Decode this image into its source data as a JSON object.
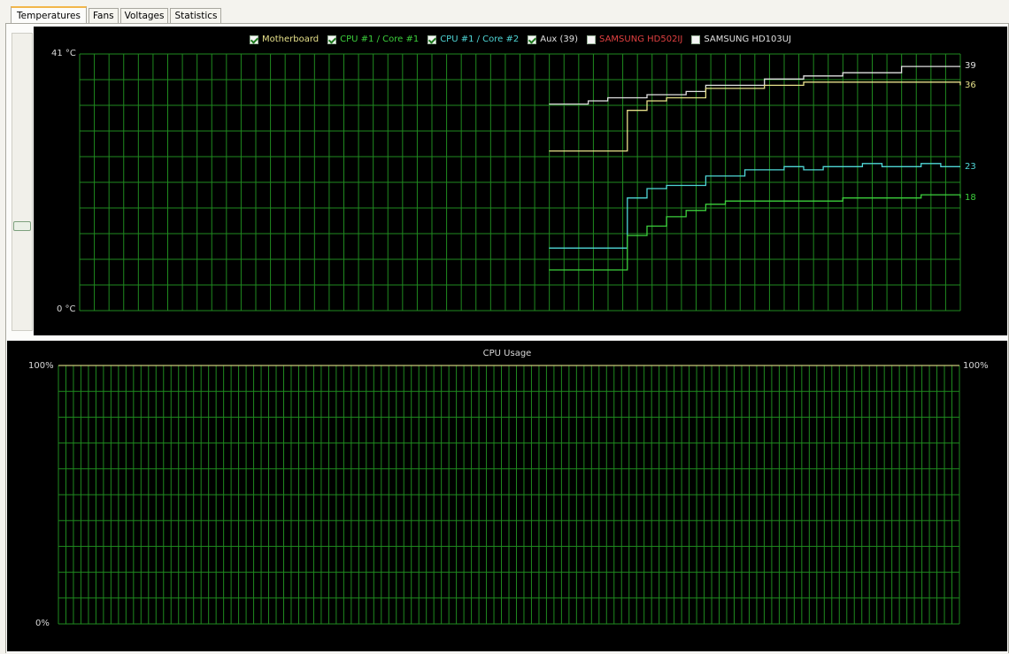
{
  "tabs": [
    {
      "label": "Temperatures",
      "active": true
    },
    {
      "label": "Fans",
      "active": false
    },
    {
      "label": "Voltages",
      "active": false
    },
    {
      "label": "Statistics",
      "active": false
    }
  ],
  "temperature_chart": {
    "legend": [
      {
        "label": "Motherboard",
        "checked": true,
        "color": "#e6e08a"
      },
      {
        "label": "CPU #1 / Core #1",
        "checked": true,
        "color": "#3ccf3c"
      },
      {
        "label": "CPU #1 / Core #2",
        "checked": true,
        "color": "#4fd6d6"
      },
      {
        "label": "Aux (39)",
        "checked": true,
        "color": "#e0e0e0"
      },
      {
        "label": "SAMSUNG HD502IJ",
        "checked": false,
        "color": "#e04040"
      },
      {
        "label": "SAMSUNG HD103UJ",
        "checked": false,
        "color": "#e0e0e0"
      }
    ],
    "y_max_label": "41 °C",
    "y_min_label": "0 °C",
    "end_labels": [
      {
        "text": "39",
        "color": "#e0e0e0"
      },
      {
        "text": "36",
        "color": "#e6e08a"
      },
      {
        "text": "23",
        "color": "#4fd6d6"
      },
      {
        "text": "18",
        "color": "#3ccf3c"
      }
    ]
  },
  "cpu_chart": {
    "title": "CPU Usage",
    "y_max_label": "100%",
    "y_min_label": "0%",
    "right_label": "100%"
  },
  "chart_data": [
    {
      "type": "line",
      "ylim": [
        0,
        41
      ],
      "grid": true,
      "legend_placement": "top-center",
      "series": [
        {
          "name": "Aux (39)",
          "color": "#e0e0e0",
          "values": [
            33,
            33,
            33.5,
            34,
            34,
            34.5,
            34.5,
            35,
            36,
            36,
            36,
            37,
            37,
            37.5,
            37.5,
            38,
            38,
            38,
            39,
            39,
            39,
            39
          ]
        },
        {
          "name": "Motherboard",
          "color": "#e6e08a",
          "values": [
            25.5,
            25.5,
            25.5,
            25.5,
            32,
            33.5,
            34,
            34,
            35.5,
            35.5,
            35.5,
            36,
            36,
            36.5,
            36.5,
            36.5,
            36.5,
            36.5,
            36.5,
            36.5,
            36.5,
            36
          ]
        },
        {
          "name": "CPU #1 / Core #2",
          "color": "#4fd6d6",
          "values": [
            10,
            10,
            10,
            10,
            18,
            19.5,
            20,
            20,
            21.5,
            21.5,
            22.5,
            22.5,
            23,
            22.5,
            23,
            23,
            23.5,
            23,
            23,
            23.5,
            23,
            23
          ]
        },
        {
          "name": "CPU #1 / Core #1",
          "color": "#3ccf3c",
          "values": [
            6.5,
            6.5,
            6.5,
            6.5,
            12,
            13.5,
            15,
            16,
            17,
            17.5,
            17.5,
            17.5,
            17.5,
            17.5,
            17.5,
            18,
            18,
            18,
            18,
            18.5,
            18.5,
            18
          ]
        }
      ]
    },
    {
      "type": "line",
      "title": "CPU Usage",
      "ylim": [
        0,
        100
      ],
      "grid": true,
      "series": [
        {
          "values": [
            100,
            100,
            100,
            100,
            100,
            100,
            100,
            100,
            100,
            100,
            100,
            100,
            100,
            100,
            100,
            100,
            100,
            100,
            100,
            100,
            100,
            100
          ]
        }
      ]
    }
  ]
}
